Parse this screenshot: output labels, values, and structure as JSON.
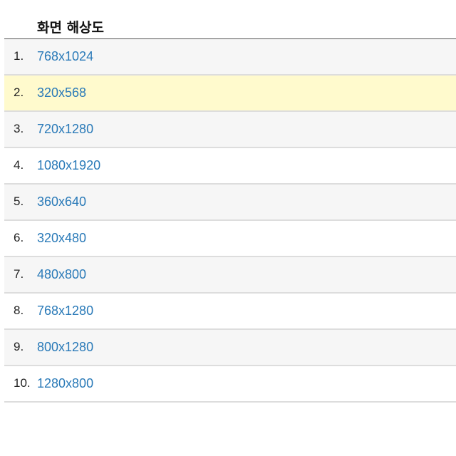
{
  "table": {
    "header": "화면 해상도",
    "rows": [
      {
        "rank": "1.",
        "resolution": "768x1024"
      },
      {
        "rank": "2.",
        "resolution": "320x568"
      },
      {
        "rank": "3.",
        "resolution": "720x1280"
      },
      {
        "rank": "4.",
        "resolution": "1080x1920"
      },
      {
        "rank": "5.",
        "resolution": "360x640"
      },
      {
        "rank": "6.",
        "resolution": "320x480"
      },
      {
        "rank": "7.",
        "resolution": "480x800"
      },
      {
        "rank": "8.",
        "resolution": "768x1280"
      },
      {
        "rank": "9.",
        "resolution": "800x1280"
      },
      {
        "rank": "10.",
        "resolution": "1280x800"
      }
    ],
    "highlighted_row_index": 1
  },
  "colors": {
    "link": "#2a7ab8",
    "highlight": "#fffacd",
    "alt_row": "#f6f6f6",
    "divider": "#dddddd"
  }
}
